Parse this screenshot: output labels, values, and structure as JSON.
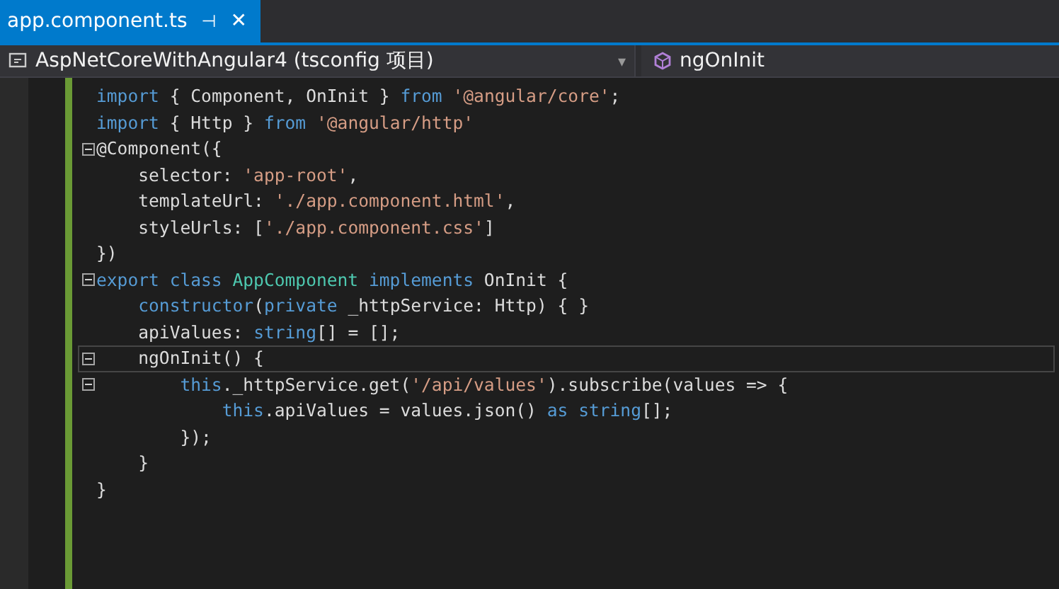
{
  "tab": {
    "title": "app.component.ts",
    "pin": "⊣",
    "close": "✕",
    "selected": true
  },
  "navbar": {
    "project": "AspNetCoreWithAngular4 (tsconfig 项目)",
    "dropdown": "▾",
    "member": "ngOnInit"
  },
  "code_lines": [
    {
      "fold": false,
      "current": false,
      "tokens": [
        {
          "kind": "keyword",
          "text": "import"
        },
        {
          "kind": "plain",
          "text": " { Component, OnInit } "
        },
        {
          "kind": "keyword",
          "text": "from"
        },
        {
          "kind": "string",
          "text": " '@angular/core'"
        },
        {
          "kind": "plain",
          "text": ";"
        }
      ]
    },
    {
      "fold": false,
      "current": false,
      "tokens": [
        {
          "kind": "keyword",
          "text": "import"
        },
        {
          "kind": "plain",
          "text": " { Http } "
        },
        {
          "kind": "keyword",
          "text": "from"
        },
        {
          "kind": "string",
          "text": " '@angular/http'"
        }
      ]
    },
    {
      "fold": true,
      "current": false,
      "tokens": [
        {
          "kind": "plain",
          "text": "@Component({"
        }
      ]
    },
    {
      "fold": false,
      "current": false,
      "tokens": [
        {
          "kind": "plain",
          "text": "    selector: "
        },
        {
          "kind": "string",
          "text": "'app-root'"
        },
        {
          "kind": "plain",
          "text": ","
        }
      ]
    },
    {
      "fold": false,
      "current": false,
      "tokens": [
        {
          "kind": "plain",
          "text": "    templateUrl: "
        },
        {
          "kind": "string",
          "text": "'./app.component.html'"
        },
        {
          "kind": "plain",
          "text": ","
        }
      ]
    },
    {
      "fold": false,
      "current": false,
      "tokens": [
        {
          "kind": "plain",
          "text": "    styleUrls: ["
        },
        {
          "kind": "string",
          "text": "'./app.component.css'"
        },
        {
          "kind": "plain",
          "text": "]"
        }
      ]
    },
    {
      "fold": false,
      "current": false,
      "tokens": [
        {
          "kind": "plain",
          "text": "})"
        }
      ]
    },
    {
      "fold": true,
      "current": false,
      "tokens": [
        {
          "kind": "keyword",
          "text": "export class"
        },
        {
          "kind": "type",
          "text": " AppComponent"
        },
        {
          "kind": "keyword",
          "text": " implements"
        },
        {
          "kind": "plain",
          "text": " OnInit {"
        }
      ]
    },
    {
      "fold": false,
      "current": false,
      "tokens": [
        {
          "kind": "keyword",
          "text": "    constructor"
        },
        {
          "kind": "plain",
          "text": "("
        },
        {
          "kind": "keyword",
          "text": "private"
        },
        {
          "kind": "plain",
          "text": " _httpService: Http) { }"
        }
      ]
    },
    {
      "fold": false,
      "current": false,
      "tokens": [
        {
          "kind": "plain",
          "text": "    apiValues: "
        },
        {
          "kind": "keyword",
          "text": "string"
        },
        {
          "kind": "plain",
          "text": "[] = [];"
        }
      ]
    },
    {
      "fold": true,
      "current": true,
      "tokens": [
        {
          "kind": "plain",
          "text": "    ngOnInit() {"
        }
      ]
    },
    {
      "fold": true,
      "current": false,
      "tokens": [
        {
          "kind": "keyword",
          "text": "        this"
        },
        {
          "kind": "plain",
          "text": "._httpService.get("
        },
        {
          "kind": "string",
          "text": "'/api/values'"
        },
        {
          "kind": "plain",
          "text": ").subscribe(values => {"
        }
      ]
    },
    {
      "fold": false,
      "current": false,
      "tokens": [
        {
          "kind": "keyword",
          "text": "            this"
        },
        {
          "kind": "plain",
          "text": ".apiValues = values.json() "
        },
        {
          "kind": "keyword",
          "text": "as string"
        },
        {
          "kind": "plain",
          "text": "[];"
        }
      ]
    },
    {
      "fold": false,
      "current": false,
      "tokens": [
        {
          "kind": "plain",
          "text": "        });"
        }
      ]
    },
    {
      "fold": false,
      "current": false,
      "tokens": [
        {
          "kind": "plain",
          "text": "    }"
        }
      ]
    },
    {
      "fold": false,
      "current": false,
      "tokens": [
        {
          "kind": "plain",
          "text": "}"
        }
      ]
    }
  ]
}
